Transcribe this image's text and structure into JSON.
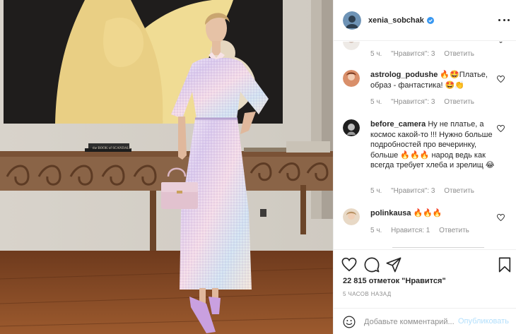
{
  "post": {
    "username": "xenia_sobchak",
    "likes_text": "22 815 отметок \"Нравится\"",
    "time_text": "5 ЧАСОВ НАЗАД"
  },
  "comments": [
    {
      "username": "",
      "text": "",
      "time": "5 ч.",
      "likes": "\"Нравится\": 3",
      "reply": "Ответить"
    },
    {
      "username": "astrolog_podushe",
      "text": "🔥🤩Платье, образ - фантастика! 🤩👏",
      "time": "5 ч.",
      "likes": "\"Нравится\": 3",
      "reply": "Ответить"
    },
    {
      "username": "before_camera",
      "text": "Ну не платье, а космос какой-то !!! Нужно больше подробностей про вечеринку, больше 🔥🔥🔥 народ ведь как всегда требует хлеба и зрелищ 😂",
      "time": "5 ч.",
      "likes": "\"Нравится\": 3",
      "reply": "Ответить"
    },
    {
      "username": "polinkausa",
      "text": "🔥🔥🔥",
      "time": "5 ч.",
      "likes": "Нравится: 1",
      "reply": "Ответить"
    }
  ],
  "add_comment": {
    "placeholder": "Добавьте комментарий...",
    "publish_label": "Опубликовать"
  },
  "photo": {
    "book_title": "the BOOK of SCANDALS"
  },
  "icons": {
    "more": "more-options-icon",
    "like": "heart-icon",
    "comment": "comment-icon",
    "share": "share-icon",
    "save": "bookmark-icon",
    "emoji": "emoji-icon",
    "verified": "verified-badge-icon",
    "comment_like": "heart-icon"
  },
  "colors": {
    "text": "#262626",
    "secondary": "#8e8e8e",
    "verified": "#3897f0",
    "publish_disabled": "#b2dffc",
    "border": "#efefef"
  }
}
